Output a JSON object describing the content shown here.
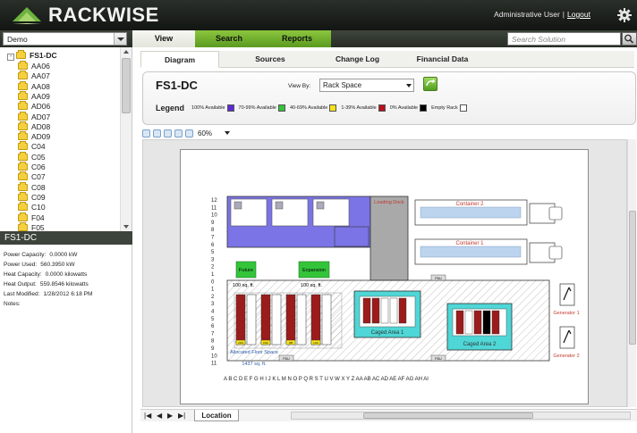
{
  "header": {
    "brand": "RACKWISE",
    "user": "Administrative User",
    "separator": "|",
    "logout": "Logout"
  },
  "nav": {
    "site_value": "Demo",
    "tabs": [
      "View",
      "Search",
      "Reports"
    ],
    "search_placeholder": "Search Solution"
  },
  "tree": {
    "root": "FS1-DC",
    "expander": "-",
    "items": [
      "AA06",
      "AA07",
      "AA08",
      "AA09",
      "AD06",
      "AD07",
      "AD08",
      "AD09",
      "C04",
      "C05",
      "C06",
      "C07",
      "C08",
      "C09",
      "C10",
      "F04",
      "F05"
    ]
  },
  "info": {
    "title": "FS1-DC",
    "rows": [
      {
        "label": "Power Capacity:",
        "value": "0.0000 kW"
      },
      {
        "label": "Power Used:",
        "value": "560.3950 kW"
      },
      {
        "label": "Heat Capacity:",
        "value": "0.0000 kilowatts"
      },
      {
        "label": "Heat Output:",
        "value": "559.8546 kilowatts"
      },
      {
        "label": "Last Modified:",
        "value": "1/28/2012 6:18 PM"
      },
      {
        "label": "Notes:",
        "value": ""
      }
    ]
  },
  "main": {
    "subtabs": [
      "Diagram",
      "Sources",
      "Change Log",
      "Financial Data"
    ],
    "title": "FS1-DC",
    "view_by_label": "View By:",
    "view_by_value": "Rack Space",
    "legend_title": "Legend",
    "legend": [
      {
        "label": "100% Available",
        "color": "#5a2bd6"
      },
      {
        "label": "70-99% Available",
        "color": "#33c43a"
      },
      {
        "label": "40-69% Available",
        "color": "#f4e31c"
      },
      {
        "label": "1-39% Available",
        "color": "#b8101a"
      },
      {
        "label": "0% Available",
        "color": "#000000"
      },
      {
        "label": "Empty Rack",
        "color": "#ffffff"
      }
    ],
    "zoom": "60%"
  },
  "diagram": {
    "loading_dock": "Loading Dock",
    "container_2": "Container 2",
    "container_1": "Container 1",
    "future": "Future",
    "expansion": "Expansion",
    "future_area": "100 sq. ft.",
    "expansion_area": "100 sq. ft.",
    "caged_area_1": "Caged Area 1",
    "caged_area_2": "Caged Area 2",
    "allocated": "Allocated Floor Space",
    "allocated_area": "1437 sq. ft.",
    "generator_1": "Generator 1",
    "generator_2": "Generator 2",
    "pdu": "PDU",
    "rack_tags": [
      "C04",
      "F03",
      "I05",
      "L04"
    ],
    "row_labels": [
      "12",
      "11",
      "10",
      "9",
      "8",
      "7",
      "6",
      "5",
      "3",
      "2",
      "1",
      "0",
      "1",
      "2",
      "3",
      "4",
      "5",
      "6",
      "7",
      "8",
      "9",
      "10",
      "11"
    ],
    "col_labels": "A  B  C  D  E  F  G  H  I  J  K  L  M  N  O  P  Q  R  S  T  U  V  W  X  Y  Z  AA AB AC AD AE AF AG AH AI"
  },
  "bottom": {
    "nav_glyphs": [
      "|◀",
      "◀",
      "▶",
      "▶|"
    ],
    "sheet_tab": "Location"
  }
}
